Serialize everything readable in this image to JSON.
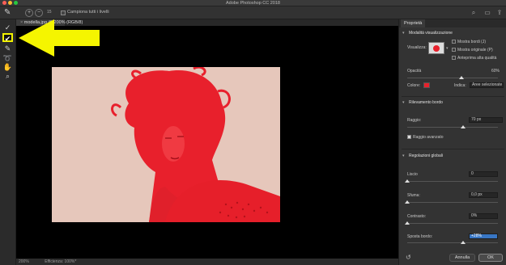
{
  "window": {
    "title": "Adobe Photoshop CC 2018"
  },
  "options_bar": {
    "brush_size": "15",
    "sample_all_layers_label": "Campiona tutti i livelli"
  },
  "document": {
    "tab_label": "modella.jpg @ 200% (RGB/8)",
    "status_zoom": "200%",
    "status_info": "Efficienza: 100%*"
  },
  "toolbar": {
    "tools": [
      "brush-refine-icon",
      "quick-selection-icon",
      "brush-icon",
      "lasso-icon",
      "hand-icon",
      "zoom-icon"
    ]
  },
  "properties": {
    "tab_label": "Proprietà",
    "view_mode": {
      "title": "Modalità visualizzazione",
      "view_label": "Visualizza:",
      "options": [
        "Mostra bordi (J)",
        "Mostra originale (P)",
        "Anteprima alta qualità"
      ],
      "options_checked": [
        false,
        false,
        false
      ]
    },
    "opacity": {
      "label": "Opacità",
      "value": "60%",
      "fraction": 0.6
    },
    "color": {
      "label": "Colore:",
      "value": "#e8212b",
      "indicates_label": "Indica:",
      "indicates_value": "Aree selezionate"
    },
    "edge_detection": {
      "title": "Rilevamento bordo",
      "radius_label": "Raggio:",
      "radius_value": "70 px",
      "radius_fraction": 0.62,
      "smart_radius_label": "Raggio avanzato",
      "smart_radius_checked": true
    },
    "global_refinements": {
      "title": "Regolazioni globali",
      "controls": [
        {
          "label": "Liscio",
          "value": "0",
          "fraction": 0.0
        },
        {
          "label": "Sfuma:",
          "value": "0,0 px",
          "fraction": 0.0
        },
        {
          "label": "Contrasto:",
          "value": "0%",
          "fraction": 0.0
        },
        {
          "label": "Sposta bordo:",
          "value": "+28%",
          "fraction": 0.62,
          "highlighted": true
        }
      ]
    },
    "buttons": {
      "cancel": "Annulla",
      "ok": "OK"
    }
  }
}
